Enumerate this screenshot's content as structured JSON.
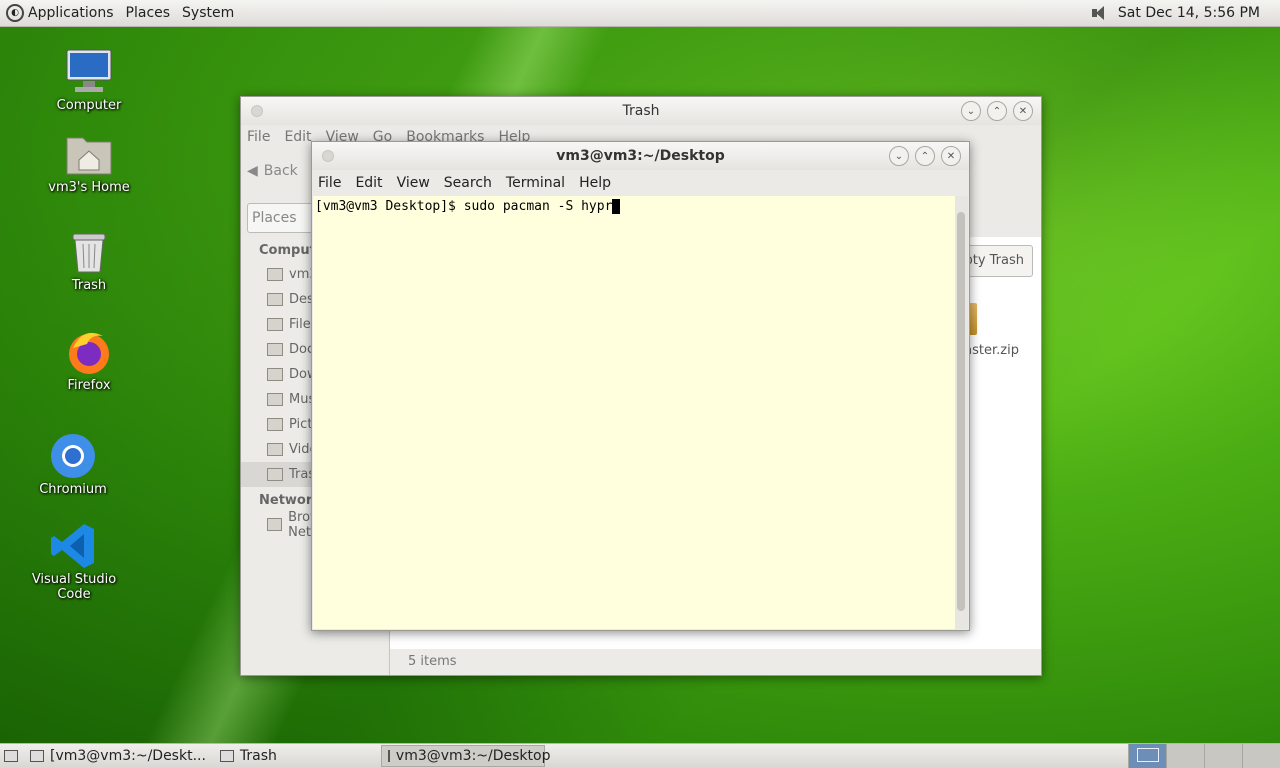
{
  "top_panel": {
    "menus": [
      "Applications",
      "Places",
      "System"
    ],
    "clock": "Sat Dec 14,  5:56 PM"
  },
  "desktop_icons": [
    {
      "label": "Computer"
    },
    {
      "label": "vm3's Home"
    },
    {
      "label": "Trash"
    },
    {
      "label": "Firefox"
    },
    {
      "label": "Chromium"
    },
    {
      "label": "Visual Studio Code"
    }
  ],
  "trash_window": {
    "title": "Trash",
    "menus": [
      "File",
      "Edit",
      "View",
      "Go",
      "Bookmarks",
      "Help"
    ],
    "back_label": "Back",
    "places_combo": "Places",
    "sidebar": {
      "computer_heading": "Computer",
      "computer_items": [
        "vm3",
        "Desktop",
        "File System",
        "Documents",
        "Downloads",
        "Music",
        "Pictures",
        "Videos",
        "Trash"
      ],
      "network_heading": "Network",
      "network_items": [
        "Browse Network"
      ]
    },
    "empty_trash_label": "Empty Trash",
    "file_label": "master.zip",
    "status": "5 items"
  },
  "terminal_window": {
    "title": "vm3@vm3:~/Desktop",
    "menus": [
      "File",
      "Edit",
      "View",
      "Search",
      "Terminal",
      "Help"
    ],
    "line": "[vm3@vm3 Desktop]$ sudo pacman -S hypr"
  },
  "taskbar": {
    "tasks": [
      "[vm3@vm3:~/Deskt...",
      "Trash",
      "vm3@vm3:~/Desktop"
    ]
  }
}
